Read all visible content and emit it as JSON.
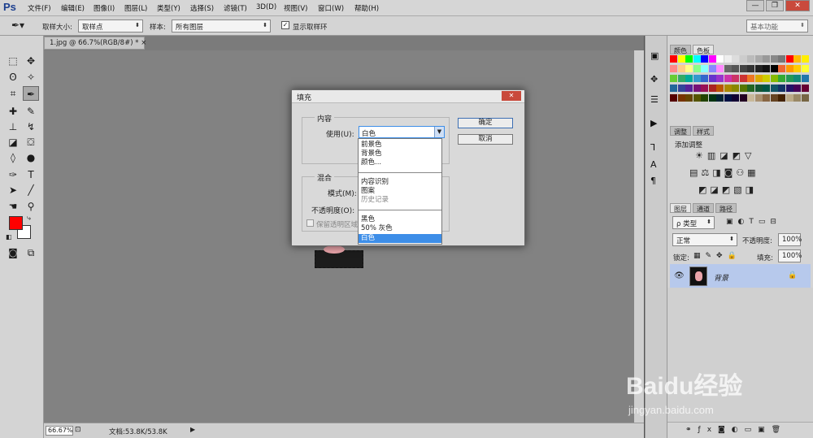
{
  "app": {
    "logo": "Ps"
  },
  "menu": [
    "文件(F)",
    "编辑(E)",
    "图像(I)",
    "图层(L)",
    "类型(Y)",
    "选择(S)",
    "滤镜(T)",
    "3D(D)",
    "视图(V)",
    "窗口(W)",
    "帮助(H)"
  ],
  "window_buttons": [
    "—",
    "❐",
    "✕"
  ],
  "options": {
    "sample_size_label": "取样大小:",
    "sample_size_value": "取样点",
    "sample_label": "样本:",
    "sample_value": "所有图层",
    "show_ring_label": "显示取样环",
    "workspace": "基本功能"
  },
  "document": {
    "tab_title": "1.jpg @ 66.7%(RGB/8#) *",
    "tab_close": "×",
    "zoom": "66.67%",
    "doc_info": "文档:53.8K/53.8K"
  },
  "panels": {
    "color_tabs": [
      "颜色",
      "色板"
    ],
    "adjust_tabs": [
      "调整",
      "样式"
    ],
    "adjust_add": "添加调整",
    "layers_tabs": [
      "图层",
      "通道",
      "路径"
    ],
    "kind_filter": "ρ 类型",
    "blend_mode": "正常",
    "opacity_label": "不透明度:",
    "opacity_value": "100%",
    "lock_label": "锁定:",
    "fill_label": "填充:",
    "fill_value": "100%",
    "layer_name": "背景"
  },
  "dialog": {
    "title": "填充",
    "close": "✕",
    "content_group": "内容",
    "use_label": "使用(U):",
    "use_value": "白色",
    "ok": "确定",
    "cancel": "取消",
    "blend_group": "混合",
    "mode_label": "模式(M):",
    "opacity_label": "不透明度(O):",
    "preserve_label": "保留透明区域"
  },
  "dropdown_options": {
    "g1": [
      "前景色",
      "背景色",
      "颜色..."
    ],
    "g2": [
      "内容识别",
      "图案",
      "历史记录"
    ],
    "g3": [
      "黑色",
      "50% 灰色",
      "白色"
    ]
  },
  "watermark": {
    "brand": "Baidu经验",
    "url": "jingyan.baidu.com"
  },
  "colors": {
    "foreground": "#ff0000",
    "background": "#ffffff",
    "selected": "#3d8ee8",
    "layer_selected": "#b7c9ec"
  }
}
